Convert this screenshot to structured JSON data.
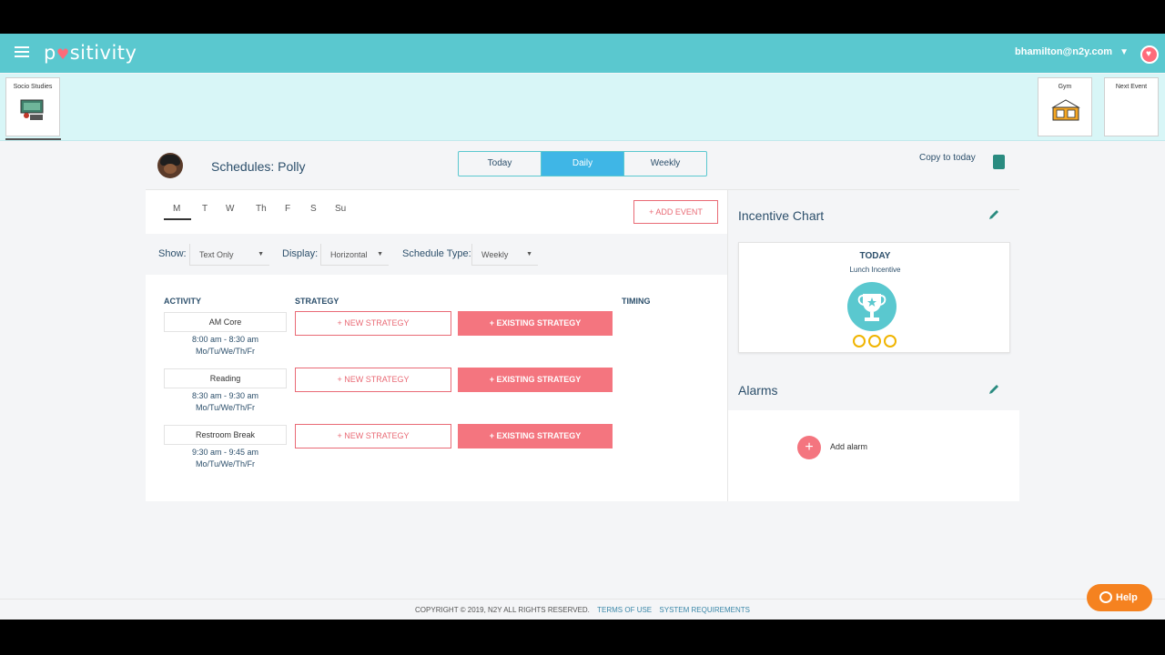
{
  "app": {
    "logo_prefix": "p",
    "logo_heart": "♥",
    "logo_suffix": "sitivity",
    "user_email": "bhamilton@n2y.com"
  },
  "event_strip": [
    {
      "label": "Socio Studies"
    },
    {
      "label": "Gym"
    },
    {
      "label": "Next Event"
    }
  ],
  "header": {
    "title": "Schedules: Polly",
    "tabs": [
      "Today",
      "Daily",
      "Weekly"
    ],
    "active_tab": "Daily",
    "copy_label": "Copy to today"
  },
  "days": [
    "M",
    "T",
    "W",
    "Th",
    "F",
    "S",
    "Su"
  ],
  "add_event_label": "+ ADD EVENT",
  "filters": {
    "show_label": "Show:",
    "show_value": "Text Only",
    "display_label": "Display:",
    "display_value": "Horizontal",
    "type_label": "Schedule Type:",
    "type_value": "Weekly"
  },
  "columns": {
    "activity": "ACTIVITY",
    "strategy": "STRATEGY",
    "timing": "TIMING"
  },
  "activities": [
    {
      "name": "AM Core",
      "time": "8:00 am - 8:30 am",
      "days": "Mo/Tu/We/Th/Fr"
    },
    {
      "name": "Reading",
      "time": "8:30 am - 9:30 am",
      "days": "Mo/Tu/We/Th/Fr"
    },
    {
      "name": "Restroom Break",
      "time": "9:30 am - 9:45 am",
      "days": "Mo/Tu/We/Th/Fr"
    }
  ],
  "strategy_buttons": {
    "new": "+ NEW STRATEGY",
    "existing": "+ EXISTING STRATEGY"
  },
  "incentive": {
    "title": "Incentive Chart",
    "today": "TODAY",
    "name": "Lunch Incentive",
    "tokens": 3
  },
  "alarms": {
    "title": "Alarms",
    "add_label": "Add alarm",
    "add_symbol": "+"
  },
  "footer": {
    "copyright": "COPYRIGHT © 2019, N2Y ALL RIGHTS RESERVED.",
    "terms": "TERMS OF USE",
    "requirements": "SYSTEM REQUIREMENTS"
  },
  "help_label": "Help",
  "colors": {
    "brand": "#5ac8cf",
    "accent": "#f4757f",
    "active_tab": "#3fb6e6",
    "help": "#f58220"
  }
}
